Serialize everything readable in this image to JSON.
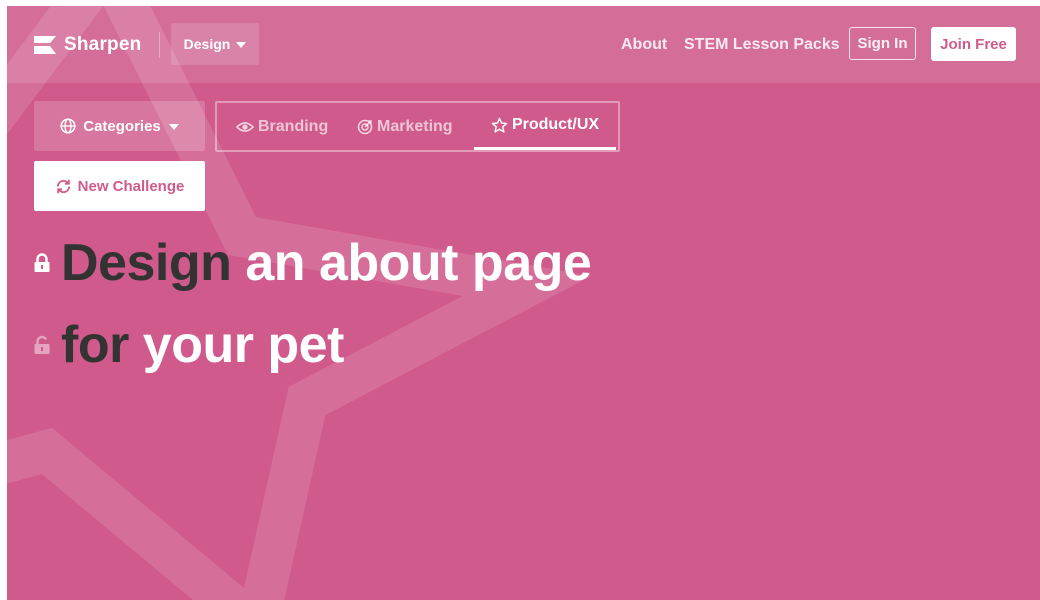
{
  "brand": {
    "name": "Sharpen"
  },
  "header": {
    "category_dropdown": "Design",
    "nav": [
      "About",
      "STEM Lesson Packs"
    ],
    "sign_in": "Sign In",
    "join": "Join Free"
  },
  "controls": {
    "categories": "Categories",
    "tabs": [
      {
        "label": "Branding",
        "icon": "eye-icon",
        "active": false
      },
      {
        "label": "Marketing",
        "icon": "target-icon",
        "active": false
      },
      {
        "label": "Product/UX",
        "icon": "star-icon",
        "active": true
      }
    ],
    "new_challenge": "New Challenge"
  },
  "challenge": {
    "line1": {
      "locked": true,
      "verb": "Design",
      "rest": "an about page"
    },
    "line2": {
      "locked": false,
      "verb": "for",
      "rest": "your pet"
    }
  },
  "colors": {
    "background": "#cf5a8b",
    "dark_text": "#333333",
    "light_text": "#ffffff"
  }
}
